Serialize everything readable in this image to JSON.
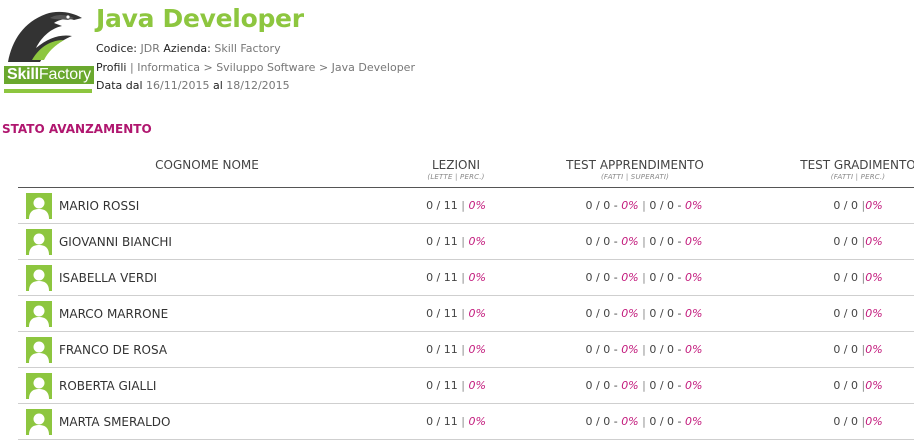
{
  "header": {
    "logo_text_bold": "Skill",
    "logo_text_rest": "Factory",
    "title": "Java Developer",
    "codice_label": "Codice:",
    "codice_value": "JDR",
    "azienda_label": "Azienda:",
    "azienda_value": "Skill Factory",
    "profili_label": "Profili",
    "profili_sep": "|",
    "profili_value": "Informatica > Sviluppo Software > Java Developer",
    "data_dal_label": "Data dal",
    "data_dal_value": "16/11/2015",
    "data_al_label": "al",
    "data_al_value": "18/12/2015"
  },
  "section": {
    "title": "STATO AVANZAMENTO"
  },
  "table": {
    "headers": {
      "name": "COGNOME NOME",
      "lezioni": "LEZIONI",
      "lezioni_sub": "(LETTE | PERC.)",
      "test": "TEST APPRENDIMENTO",
      "test_sub": "(FATTI | SUPERATI)",
      "gradimento": "TEST GRADIMENTO",
      "gradimento_sub": "(FATTI | PERC.)"
    },
    "rows": [
      {
        "name": "MARIO ROSSI",
        "lez": "0 / 11",
        "lez_pct": "0%",
        "t1": "0 / 0 -",
        "t1_pct": "0%",
        "t2": "0 / 0 -",
        "t2_pct": "0%",
        "grad": "0 / 0",
        "grad_pct": "0%"
      },
      {
        "name": "GIOVANNI BIANCHI",
        "lez": "0 / 11",
        "lez_pct": "0%",
        "t1": "0 / 0 -",
        "t1_pct": "0%",
        "t2": "0 / 0 -",
        "t2_pct": "0%",
        "grad": "0 / 0",
        "grad_pct": "0%"
      },
      {
        "name": "ISABELLA VERDI",
        "lez": "0 / 11",
        "lez_pct": "0%",
        "t1": "0 / 0 -",
        "t1_pct": "0%",
        "t2": "0 / 0 -",
        "t2_pct": "0%",
        "grad": "0 / 0",
        "grad_pct": "0%"
      },
      {
        "name": "MARCO MARRONE",
        "lez": "0 / 11",
        "lez_pct": "0%",
        "t1": "0 / 0 -",
        "t1_pct": "0%",
        "t2": "0 / 0 -",
        "t2_pct": "0%",
        "grad": "0 / 0",
        "grad_pct": "0%"
      },
      {
        "name": "FRANCO DE ROSA",
        "lez": "0 / 11",
        "lez_pct": "0%",
        "t1": "0 / 0 -",
        "t1_pct": "0%",
        "t2": "0 / 0 -",
        "t2_pct": "0%",
        "grad": "0 / 0",
        "grad_pct": "0%"
      },
      {
        "name": "ROBERTA GIALLI",
        "lez": "0 / 11",
        "lez_pct": "0%",
        "t1": "0 / 0 -",
        "t1_pct": "0%",
        "t2": "0 / 0 -",
        "t2_pct": "0%",
        "grad": "0 / 0",
        "grad_pct": "0%"
      },
      {
        "name": "MARTA SMERALDO",
        "lez": "0 / 11",
        "lez_pct": "0%",
        "t1": "0 / 0 -",
        "t1_pct": "0%",
        "t2": "0 / 0 -",
        "t2_pct": "0%",
        "grad": "0 / 0",
        "grad_pct": "0%"
      }
    ]
  },
  "colors": {
    "accent_green": "#8dc63f",
    "accent_magenta": "#b0166f",
    "percent": "#c2187b"
  },
  "icons": {
    "logo": "falcon-logo-icon",
    "avatar": "user-avatar-icon"
  }
}
